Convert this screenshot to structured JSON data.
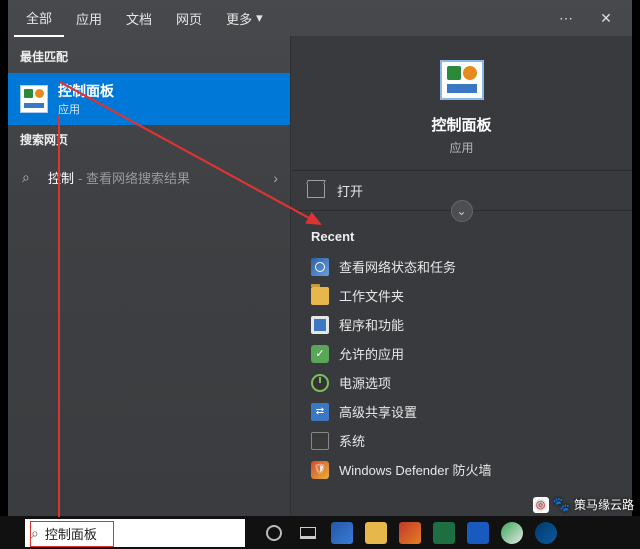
{
  "tabs": {
    "all": "全部",
    "apps": "应用",
    "docs": "文档",
    "web": "网页",
    "more": "更多"
  },
  "window": {
    "more_menu": "⋯",
    "close": "✕"
  },
  "left": {
    "best_match_header": "最佳匹配",
    "best_match": {
      "title": "控制面板",
      "subtitle": "应用"
    },
    "search_web_header": "搜索网页",
    "web_item": {
      "query": "控制",
      "hint": "- 查看网络搜索结果",
      "chevron": "›"
    }
  },
  "preview": {
    "title": "控制面板",
    "subtitle": "应用",
    "open_action": "打开",
    "expand": "⌄",
    "recent_header": "Recent",
    "recent": [
      {
        "icon": "ic-net",
        "label": "查看网络状态和任务"
      },
      {
        "icon": "ic-folder",
        "label": "工作文件夹"
      },
      {
        "icon": "ic-prog",
        "label": "程序和功能"
      },
      {
        "icon": "ic-allow",
        "label": "允许的应用"
      },
      {
        "icon": "ic-power",
        "label": "电源选项"
      },
      {
        "icon": "ic-share",
        "label": "高级共享设置"
      },
      {
        "icon": "ic-sys",
        "label": "系统"
      },
      {
        "icon": "ic-def",
        "label": "Windows Defender 防火墙"
      }
    ]
  },
  "search": {
    "icon": "⌕",
    "value": "控制面板"
  },
  "watermark": {
    "logo": "◎",
    "paw": "🐾",
    "text": "策马缘云路"
  }
}
